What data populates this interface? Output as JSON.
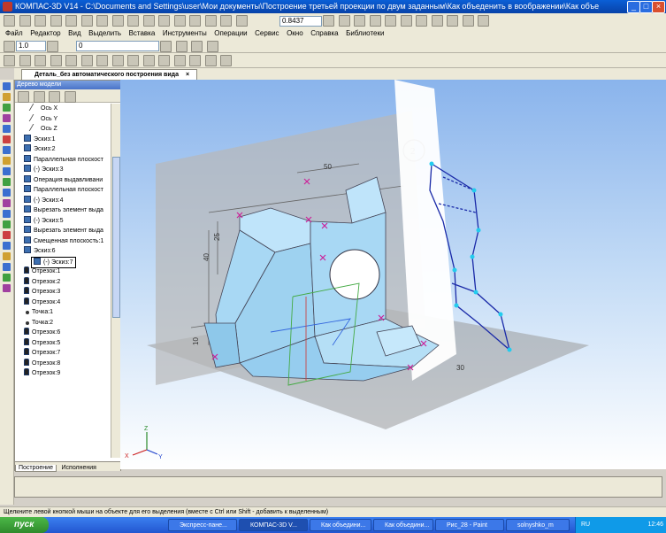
{
  "window": {
    "title": "КОМПАС-3D V14 - C:\\Documents and Settings\\user\\Мои документы\\Построение третьей проекции по двум заданным\\Как объеденить в воображении\\Как объеденить в вообрах",
    "min_label": "_",
    "max_label": "□",
    "close_label": "×"
  },
  "toolbar": {
    "zoom_value": "0.8437",
    "scale_value": "1.0",
    "layer_value": "0"
  },
  "menu": {
    "items": [
      "Файл",
      "Редактор",
      "Вид",
      "Выделить",
      "Вставка",
      "Инструменты",
      "Операции",
      "Сервис",
      "Окно",
      "Справка",
      "Библиотеки"
    ]
  },
  "doc": {
    "tab_label": "Деталь_без автоматического построения вида",
    "close_label": "×"
  },
  "tree": {
    "header": "Дерево модели",
    "items": [
      {
        "label": "Ось X",
        "indent": 2,
        "icon": "axis-x-icon"
      },
      {
        "label": "Ось Y",
        "indent": 2,
        "icon": "axis-y-icon"
      },
      {
        "label": "Ось Z",
        "indent": 2,
        "icon": "axis-z-icon"
      },
      {
        "label": "Эскиз:1",
        "indent": 1,
        "icon": "sketch-icon"
      },
      {
        "label": "Эскиз:2",
        "indent": 1,
        "icon": "sketch-icon"
      },
      {
        "label": "Параллельная плоскост",
        "indent": 1,
        "icon": "plane-icon"
      },
      {
        "label": "(-) Эскиз:3",
        "indent": 1,
        "icon": "sketch-icon"
      },
      {
        "label": "Операция выдавливани",
        "indent": 1,
        "icon": "extrude-icon"
      },
      {
        "label": "Параллельная плоскост",
        "indent": 1,
        "icon": "plane-icon"
      },
      {
        "label": "(-) Эскиз:4",
        "indent": 1,
        "icon": "sketch-icon"
      },
      {
        "label": "Вырезать элемент выда",
        "indent": 1,
        "icon": "cut-icon"
      },
      {
        "label": "(-) Эскиз:5",
        "indent": 1,
        "icon": "sketch-icon"
      },
      {
        "label": "Вырезать элемент выда",
        "indent": 1,
        "icon": "cut-icon"
      },
      {
        "label": "Смещенная плоскость:1",
        "indent": 1,
        "icon": "plane-icon"
      },
      {
        "label": "Эскиз:6",
        "indent": 1,
        "icon": "sketch-icon"
      },
      {
        "label": "(-) Эскиз:7",
        "indent": 2,
        "icon": "sketch-icon",
        "selected": true
      },
      {
        "label": "Отрезок:1",
        "indent": 1,
        "icon": "segment-icon"
      },
      {
        "label": "Отрезок:2",
        "indent": 1,
        "icon": "segment-icon"
      },
      {
        "label": "Отрезок:3",
        "indent": 1,
        "icon": "segment-icon"
      },
      {
        "label": "Отрезок:4",
        "indent": 1,
        "icon": "segment-icon"
      },
      {
        "label": "Точка:1",
        "indent": 1,
        "icon": "point-icon"
      },
      {
        "label": "Точка:2",
        "indent": 1,
        "icon": "point-icon"
      },
      {
        "label": "Отрезок:6",
        "indent": 1,
        "icon": "segment-icon"
      },
      {
        "label": "Отрезок:5",
        "indent": 1,
        "icon": "segment-icon"
      },
      {
        "label": "Отрезок:7",
        "indent": 1,
        "icon": "segment-icon"
      },
      {
        "label": "Отрезок:8",
        "indent": 1,
        "icon": "segment-icon"
      },
      {
        "label": "Отрезок:9",
        "indent": 1,
        "icon": "segment-icon"
      }
    ],
    "tabs": [
      "Построение",
      "Исполнения"
    ]
  },
  "drawing": {
    "sheet_number": "2",
    "dims": [
      "50",
      "25",
      "40",
      "10",
      "30"
    ],
    "axis_labels": {
      "x": "X",
      "y": "Y",
      "z": "Z"
    }
  },
  "status": {
    "text": "Щелкните левой кнопкой мыши на объекте для его выделения (вместе с Ctrl или Shift - добавить к выделенным)"
  },
  "taskbar": {
    "start_label": "пуск",
    "tasks": [
      "Экспресс-пане...",
      "КОМПАС-3D V...",
      "Как объедини...",
      "Как объедини...",
      "Рис_28 - Paint",
      "solnyshko_m"
    ],
    "lang": "RU",
    "clock": "12:46"
  },
  "colors": {
    "accent": "#0a5fd6",
    "model_face": "#a8d8f4",
    "sketch_line": "#1a2aa8",
    "point_marker": "#cc2299"
  }
}
